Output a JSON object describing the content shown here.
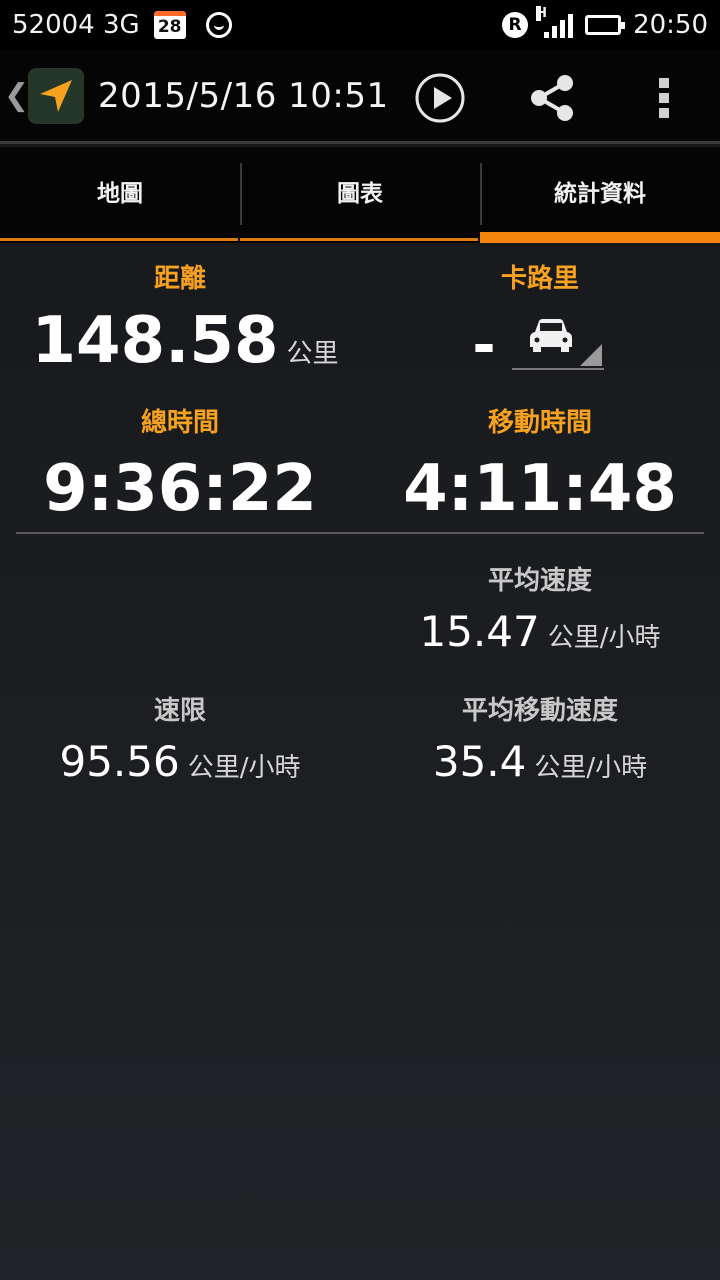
{
  "status_bar": {
    "carrier": "52004 3G",
    "calendar_day": "28",
    "roaming": "R",
    "network_type": "H",
    "time": "20:50",
    "battery_color": "#3bd13b"
  },
  "action_bar": {
    "title": "2015/5/16 10:51",
    "icons": [
      "back-chevron-icon",
      "navigation-arrow-icon",
      "play-icon",
      "share-icon",
      "overflow-menu-icon"
    ],
    "accent": "#f7a120"
  },
  "tabs": [
    {
      "label": "地圖",
      "active": false
    },
    {
      "label": "圖表",
      "active": false
    },
    {
      "label": "統計資料",
      "active": true
    }
  ],
  "stats": {
    "distance": {
      "label": "距離",
      "value": "148.58",
      "unit": "公里"
    },
    "calories": {
      "label": "卡路里",
      "value": "-",
      "activity_icon": "car-icon"
    },
    "total_time": {
      "label": "總時間",
      "value": "9:36:22"
    },
    "moving_time": {
      "label": "移動時間",
      "value": "4:11:48"
    },
    "avg_speed": {
      "label": "平均速度",
      "value": "15.47",
      "unit": "公里/小時"
    },
    "max_speed": {
      "label": "速限",
      "value": "95.56",
      "unit": "公里/小時"
    },
    "avg_moving_speed": {
      "label": "平均移動速度",
      "value": "35.4",
      "unit": "公里/小時"
    }
  }
}
